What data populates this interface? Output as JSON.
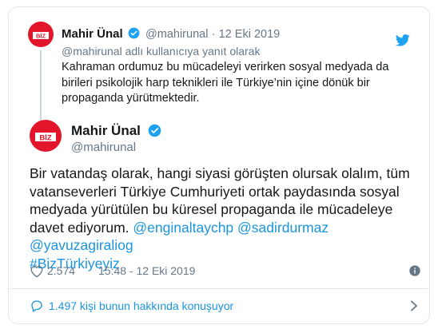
{
  "quoted_tweet": {
    "author_name": "Mahir Ünal",
    "handle": "@mahirunal",
    "separator": "·",
    "date": "12 Eki 2019",
    "reply_context": "@mahirunal adlı kullanıcıya yanıt olarak",
    "text": "Kahraman ordumuz bu mücadeleyi verirken sosyal medyada da birileri psikolojik harp teknikleri ile Türkiye’nin içine dönük bir propaganda yürütmektedir."
  },
  "tweet": {
    "author_name": "Mahir Ünal",
    "handle": "@mahirunal",
    "text_plain": "Bir vatandaş olarak, hangi siyasi görüşten olursak olalım, tüm vatanseverleri Türkiye Cumhuriyeti ortak paydasında sosyal medyada yürütülen bu küresel propaganda ile mücadeleye davet ediyorum.",
    "mentions": [
      "@enginaltaychp",
      "@sadirdurmaz",
      "@yavuzagiraliog"
    ],
    "hashtag": "#BizTürkiyeyiz",
    "likes": "2.574",
    "timestamp": "15:48 - 12 Eki 2019"
  },
  "conversation_link": "1.497 kişi bunun hakkında konuşuyor",
  "avatar_text": "BİZ",
  "icons": {
    "verified": "verified-badge-icon",
    "twitter_bird": "twitter-bird-icon",
    "heart": "heart-icon",
    "info": "info-icon",
    "reply_bubble": "reply-bubble-icon",
    "chevron": "chevron-right-icon"
  },
  "colors": {
    "accent": "#1b95e0",
    "text": "#14171a",
    "muted": "#657786",
    "avatar_red": "#e3152a",
    "border": "#e1e8ed"
  }
}
